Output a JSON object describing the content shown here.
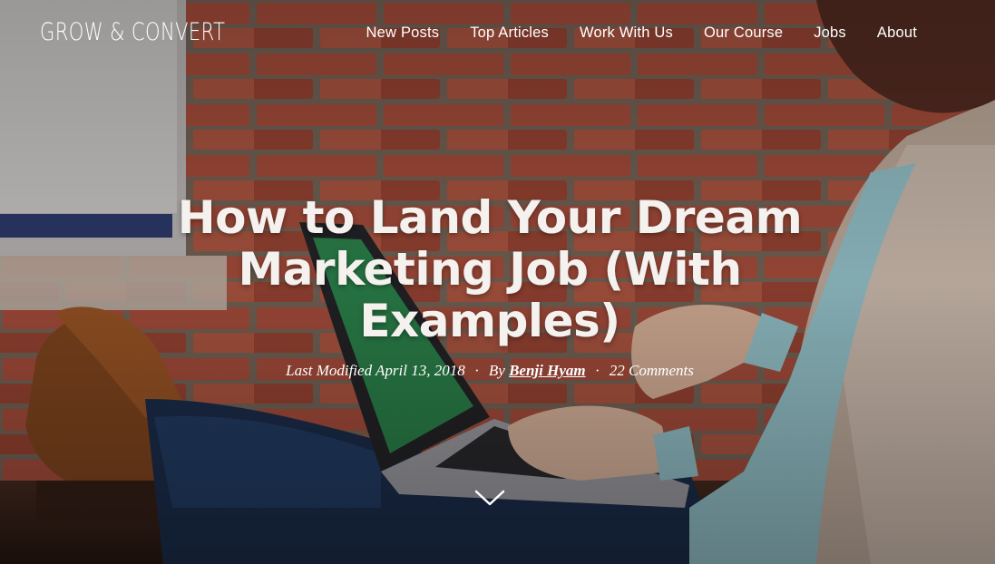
{
  "site": {
    "logo_text": "GROW & CONVERT"
  },
  "nav": {
    "items": [
      {
        "label": "New Posts"
      },
      {
        "label": "Top Articles"
      },
      {
        "label": "Work With Us"
      },
      {
        "label": "Our Course"
      },
      {
        "label": "Jobs"
      },
      {
        "label": "About"
      }
    ]
  },
  "article": {
    "title": "How to Land Your Dream Marketing Job (With Examples)",
    "last_modified_label": "Last Modified",
    "last_modified_date": "April 13, 2018",
    "by_label": "By",
    "author": "Benji Hyam",
    "comments": "22 Comments",
    "separator": "·"
  },
  "icons": {
    "scroll": "chevron-down-icon"
  },
  "colors": {
    "text": "#ffffff",
    "brick": "#a5503d",
    "overlay": "#000000"
  }
}
